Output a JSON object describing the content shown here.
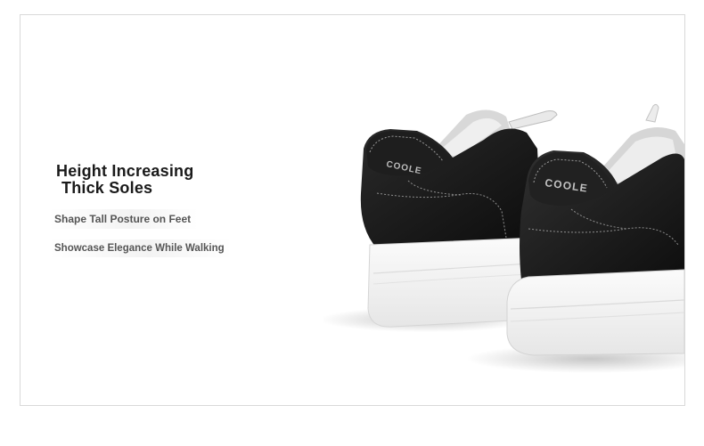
{
  "promo": {
    "headline_line1": "Height Increasing",
    "headline_line2": "Thick Soles",
    "feature_1": "Shape Tall Posture on Feet",
    "feature_2": "Showcase Elegance While Walking"
  },
  "product": {
    "brand_mark": "COOLE",
    "upper_color": "#151515",
    "sole_color": "#f4f4f4"
  }
}
